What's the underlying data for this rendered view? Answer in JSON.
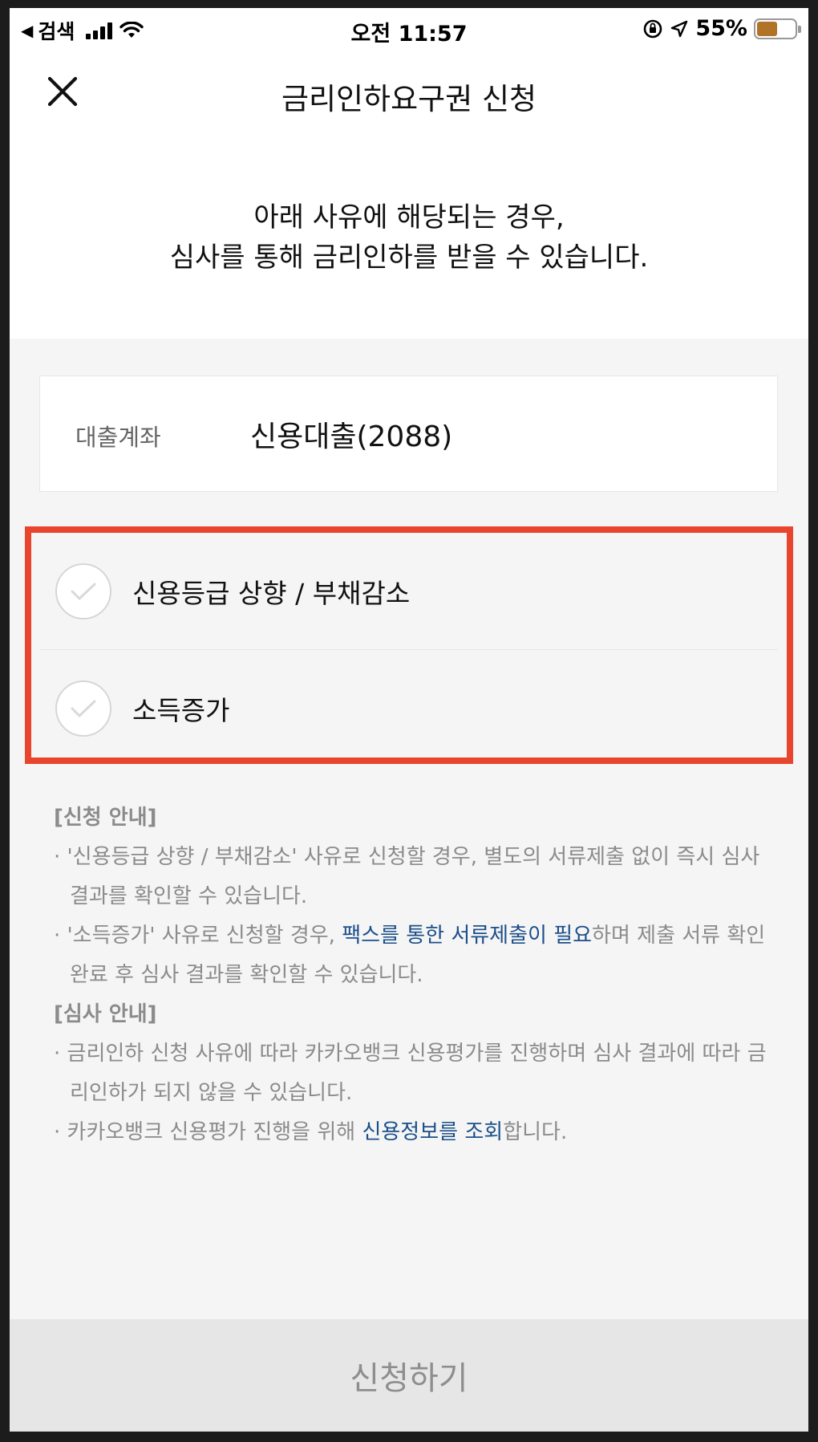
{
  "status_bar": {
    "back_label": "◀",
    "app_label": "검색",
    "time": "오전 11:57",
    "battery_percent": "55%",
    "battery_level": 0.55,
    "battery_color": "#b07327"
  },
  "nav": {
    "title": "금리인하요구권 신청",
    "close_icon": "close-icon"
  },
  "intro": {
    "line1": "아래 사유에 해당되는 경우,",
    "line2": "심사를 통해 금리인하를 받을 수 있습니다."
  },
  "account": {
    "label": "대출계좌",
    "value": "신용대출(2088)"
  },
  "reasons": [
    {
      "label": "신용등급 상향 / 부채감소",
      "checked": false
    },
    {
      "label": "소득증가",
      "checked": false
    }
  ],
  "notice": {
    "apply_heading": "[신청 안내]",
    "apply_item1": "· '신용등급 상향 / 부채감소' 사유로 신청할 경우, 별도의 서류제출 없이 즉시 심사 결과를 확인할 수 있습니다.",
    "apply_item2_pre": "· '소득증가' 사유로 신청할 경우, ",
    "apply_item2_link": "팩스를 통한 서류제출이 필요",
    "apply_item2_post": "하며 제출 서류 확인 완료 후 심사 결과를 확인할 수 있습니다.",
    "review_heading": "[심사 안내]",
    "review_item1": "· 금리인하 신청 사유에 따라 카카오뱅크 신용평가를 진행하며 심사 결과에 따라 금리인하가 되지 않을 수 있습니다.",
    "review_item2_pre": "· 카카오뱅크 신용평가 진행을 위해 ",
    "review_item2_link": "신용정보를 조회",
    "review_item2_post": "합니다."
  },
  "submit": {
    "label": "신청하기"
  },
  "colors": {
    "highlight": "#e9452e",
    "link": "#1b4f8a",
    "muted_text": "#8b8b8b"
  }
}
